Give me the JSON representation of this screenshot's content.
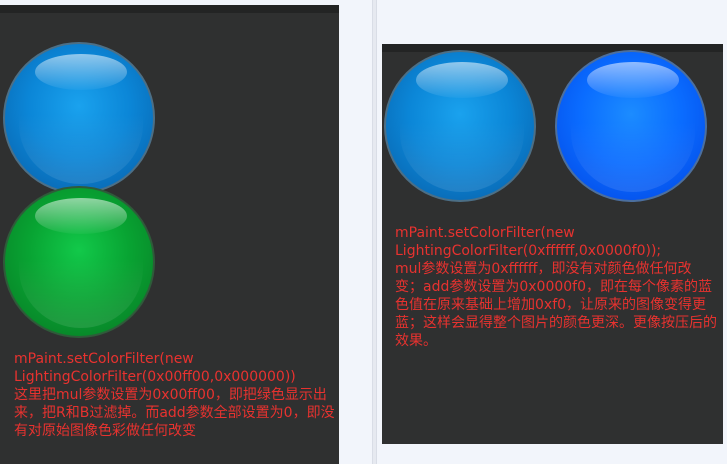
{
  "left_panel": {
    "code": "mPaint.setColorFilter(new LightingColorFilter(0x00ff00,0x000000))",
    "description": "这里把mul参数设置为0x00ff00，即把绿色显示出来，把R和B过滤掉。而add参数全部设置为0，即没有对原始图像色彩做任何改变"
  },
  "right_panel": {
    "code": "mPaint.setColorFilter(new LightingColorFilter(0xffffff,0x0000f0));",
    "description": "mul参数设置为0xffffff，即没有对颜色做任何改变；add参数设置为0x0000f0，即在每个像素的蓝色值在原来基础上增加0xf0，让原来的图像变得更蓝；这样会显得整个图片的颜色更深。更像按压后的效果。"
  },
  "colors": {
    "panel_background": "#2f3030",
    "caption_text": "#e8322f",
    "original_orb": "#0b86d7",
    "green_orb": "#08a332",
    "bluer_orb": "#0a6cff"
  },
  "icons": [
    "blue-orb-icon",
    "green-orb-icon",
    "bright-blue-orb-icon"
  ]
}
